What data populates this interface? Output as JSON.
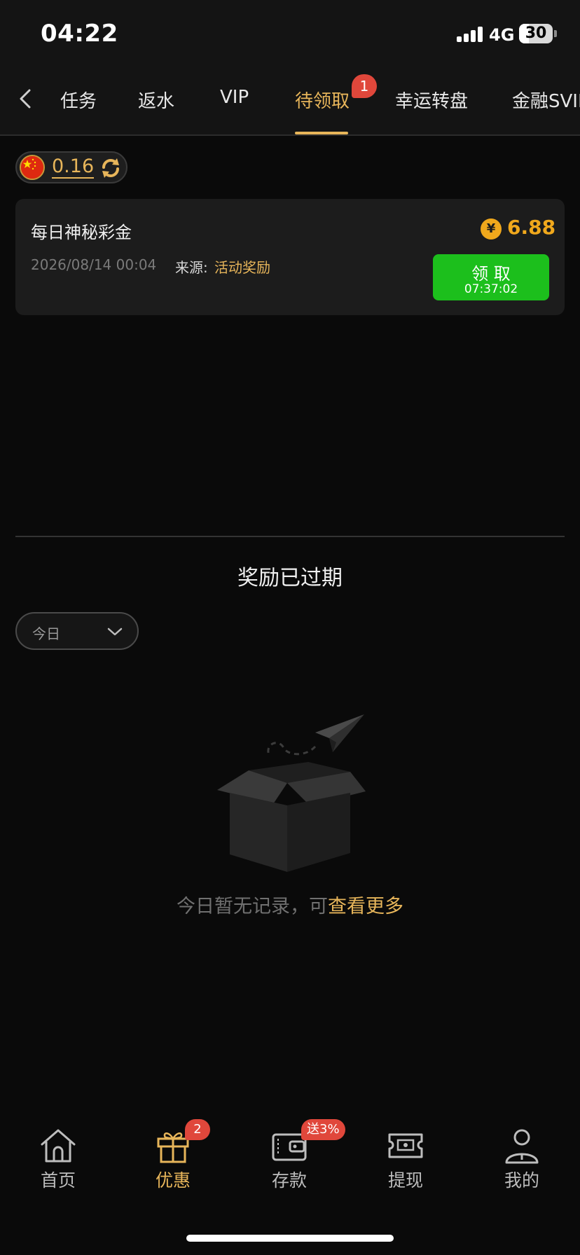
{
  "status_bar": {
    "time": "04:22",
    "network": "4G",
    "battery": "30"
  },
  "tabs": {
    "items": [
      {
        "label": "任务"
      },
      {
        "label": "返水"
      },
      {
        "label": "VIP"
      },
      {
        "label": "待领取",
        "badge": "1"
      },
      {
        "label": "幸运转盘"
      },
      {
        "label": "金融SVIP"
      }
    ],
    "active_index": 3
  },
  "balance": {
    "value": "0.16"
  },
  "reward": {
    "title": "每日神秘彩金",
    "coin_symbol": "¥",
    "amount": "6.88",
    "datetime": "2026/08/14 00:04",
    "source_label": "来源:",
    "source_value": "活动奖励",
    "claim_label": "领 取",
    "claim_timer": "07:37:02"
  },
  "expired": {
    "title": "奖励已过期",
    "filter_value": "今日",
    "empty_text": "今日暂无记录，可",
    "empty_link": "查看更多"
  },
  "bottom_nav": {
    "items": [
      {
        "label": "首页",
        "icon": "home-icon"
      },
      {
        "label": "优惠",
        "icon": "gift-icon",
        "badge": "2"
      },
      {
        "label": "存款",
        "icon": "wallet-icon",
        "badge": "送3%"
      },
      {
        "label": "提现",
        "icon": "withdraw-ticket-icon"
      },
      {
        "label": "我的",
        "icon": "profile-icon"
      }
    ],
    "active_index": 1
  },
  "colors": {
    "accent": "#e7b55a",
    "claim_button": "#1cbf1c",
    "badge": "#e0473b",
    "amount": "#f0a81c"
  }
}
